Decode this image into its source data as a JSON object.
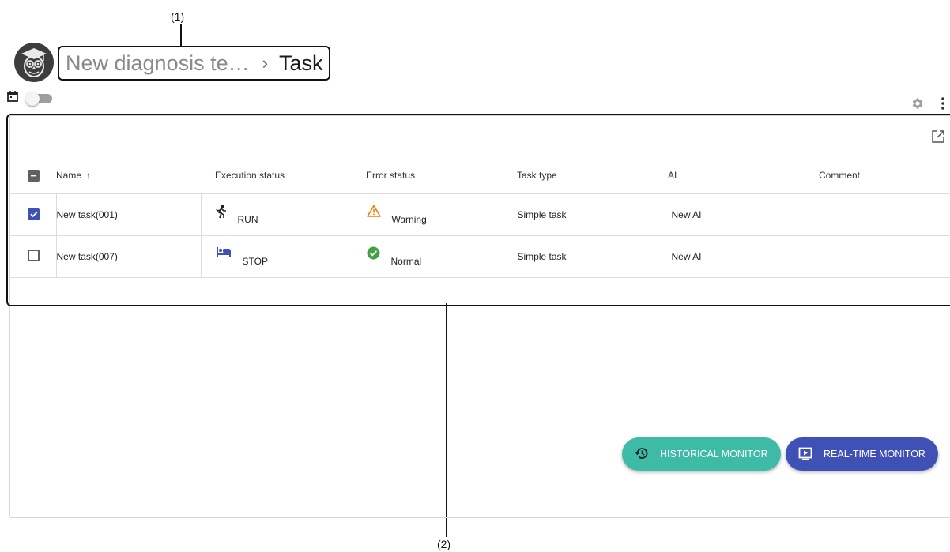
{
  "callouts": {
    "one": "(1)",
    "two": "(2)"
  },
  "breadcrumb": {
    "parent": "New diagnosis te…",
    "separator": "›",
    "current": "Task"
  },
  "table": {
    "columns": {
      "name": "Name",
      "sort": "↑",
      "execution": "Execution status",
      "error": "Error status",
      "type": "Task type",
      "ai": "AI",
      "comment": "Comment"
    },
    "rows": [
      {
        "checked": true,
        "name": "New task(001)",
        "execution_icon": "run-icon",
        "execution": "RUN",
        "error_icon": "warning-icon",
        "error": "Warning",
        "type": "Simple task",
        "ai": "New AI",
        "comment": ""
      },
      {
        "checked": false,
        "name": "New task(007)",
        "execution_icon": "sleep-icon",
        "execution": "STOP",
        "error_icon": "check-circle-icon",
        "error": "Normal",
        "type": "Simple task",
        "ai": "New AI",
        "comment": ""
      }
    ]
  },
  "buttons": {
    "historical": "HISTORICAL MONITOR",
    "realtime": "REAL-TIME MONITOR"
  },
  "colors": {
    "accent_blue": "#3f51b5",
    "accent_teal": "#3dbba6",
    "warning": "#f57c00",
    "normal": "#43a047"
  }
}
